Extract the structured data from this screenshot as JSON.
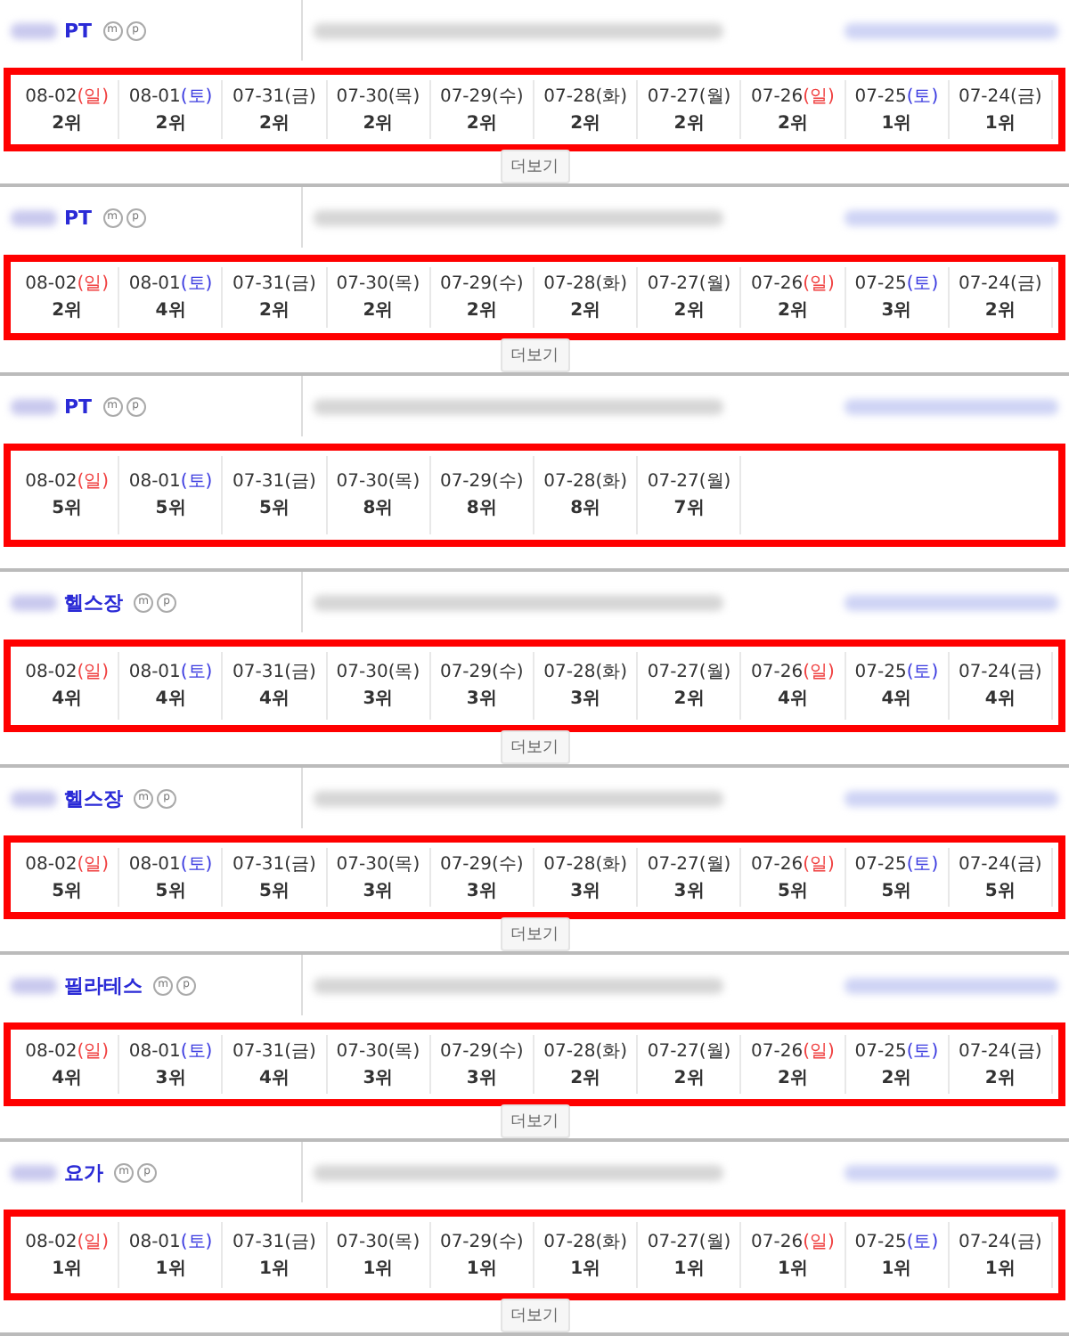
{
  "sections": [
    {
      "keyword": "PT",
      "badges": [
        "m",
        "p"
      ],
      "more_button": "더보기",
      "days": [
        {
          "date": "08-02",
          "day": "(일)",
          "kind": "sunday",
          "rank": "2위"
        },
        {
          "date": "08-01",
          "day": "(토)",
          "kind": "saturday",
          "rank": "2위"
        },
        {
          "date": "07-31",
          "day": "(금)",
          "kind": "weekday",
          "rank": "2위"
        },
        {
          "date": "07-30",
          "day": "(목)",
          "kind": "weekday",
          "rank": "2위"
        },
        {
          "date": "07-29",
          "day": "(수)",
          "kind": "weekday",
          "rank": "2위"
        },
        {
          "date": "07-28",
          "day": "(화)",
          "kind": "weekday",
          "rank": "2위"
        },
        {
          "date": "07-27",
          "day": "(월)",
          "kind": "weekday",
          "rank": "2위"
        },
        {
          "date": "07-26",
          "day": "(일)",
          "kind": "sunday",
          "rank": "2위"
        },
        {
          "date": "07-25",
          "day": "(토)",
          "kind": "saturday",
          "rank": "1위"
        },
        {
          "date": "07-24",
          "day": "(금)",
          "kind": "weekday",
          "rank": "1위"
        }
      ]
    },
    {
      "keyword": "PT",
      "badges": [
        "m",
        "p"
      ],
      "more_button": "더보기",
      "days": [
        {
          "date": "08-02",
          "day": "(일)",
          "kind": "sunday",
          "rank": "2위"
        },
        {
          "date": "08-01",
          "day": "(토)",
          "kind": "saturday",
          "rank": "4위"
        },
        {
          "date": "07-31",
          "day": "(금)",
          "kind": "weekday",
          "rank": "2위"
        },
        {
          "date": "07-30",
          "day": "(목)",
          "kind": "weekday",
          "rank": "2위"
        },
        {
          "date": "07-29",
          "day": "(수)",
          "kind": "weekday",
          "rank": "2위"
        },
        {
          "date": "07-28",
          "day": "(화)",
          "kind": "weekday",
          "rank": "2위"
        },
        {
          "date": "07-27",
          "day": "(월)",
          "kind": "weekday",
          "rank": "2위"
        },
        {
          "date": "07-26",
          "day": "(일)",
          "kind": "sunday",
          "rank": "2위"
        },
        {
          "date": "07-25",
          "day": "(토)",
          "kind": "saturday",
          "rank": "3위"
        },
        {
          "date": "07-24",
          "day": "(금)",
          "kind": "weekday",
          "rank": "2위"
        }
      ]
    },
    {
      "keyword": "PT",
      "badges": [
        "m",
        "p"
      ],
      "days": [
        {
          "date": "08-02",
          "day": "(일)",
          "kind": "sunday",
          "rank": "5위"
        },
        {
          "date": "08-01",
          "day": "(토)",
          "kind": "saturday",
          "rank": "5위"
        },
        {
          "date": "07-31",
          "day": "(금)",
          "kind": "weekday",
          "rank": "5위"
        },
        {
          "date": "07-30",
          "day": "(목)",
          "kind": "weekday",
          "rank": "8위"
        },
        {
          "date": "07-29",
          "day": "(수)",
          "kind": "weekday",
          "rank": "8위"
        },
        {
          "date": "07-28",
          "day": "(화)",
          "kind": "weekday",
          "rank": "8위"
        },
        {
          "date": "07-27",
          "day": "(월)",
          "kind": "weekday",
          "rank": "7위"
        }
      ]
    },
    {
      "keyword": "헬스장",
      "badges": [
        "m",
        "p"
      ],
      "more_button": "더보기",
      "days": [
        {
          "date": "08-02",
          "day": "(일)",
          "kind": "sunday",
          "rank": "4위"
        },
        {
          "date": "08-01",
          "day": "(토)",
          "kind": "saturday",
          "rank": "4위"
        },
        {
          "date": "07-31",
          "day": "(금)",
          "kind": "weekday",
          "rank": "4위"
        },
        {
          "date": "07-30",
          "day": "(목)",
          "kind": "weekday",
          "rank": "3위"
        },
        {
          "date": "07-29",
          "day": "(수)",
          "kind": "weekday",
          "rank": "3위"
        },
        {
          "date": "07-28",
          "day": "(화)",
          "kind": "weekday",
          "rank": "3위"
        },
        {
          "date": "07-27",
          "day": "(월)",
          "kind": "weekday",
          "rank": "2위"
        },
        {
          "date": "07-26",
          "day": "(일)",
          "kind": "sunday",
          "rank": "4위"
        },
        {
          "date": "07-25",
          "day": "(토)",
          "kind": "saturday",
          "rank": "4위"
        },
        {
          "date": "07-24",
          "day": "(금)",
          "kind": "weekday",
          "rank": "4위"
        }
      ]
    },
    {
      "keyword": "헬스장",
      "badges": [
        "m",
        "p"
      ],
      "more_button": "더보기",
      "days": [
        {
          "date": "08-02",
          "day": "(일)",
          "kind": "sunday",
          "rank": "5위"
        },
        {
          "date": "08-01",
          "day": "(토)",
          "kind": "saturday",
          "rank": "5위"
        },
        {
          "date": "07-31",
          "day": "(금)",
          "kind": "weekday",
          "rank": "5위"
        },
        {
          "date": "07-30",
          "day": "(목)",
          "kind": "weekday",
          "rank": "3위"
        },
        {
          "date": "07-29",
          "day": "(수)",
          "kind": "weekday",
          "rank": "3위"
        },
        {
          "date": "07-28",
          "day": "(화)",
          "kind": "weekday",
          "rank": "3위"
        },
        {
          "date": "07-27",
          "day": "(월)",
          "kind": "weekday",
          "rank": "3위"
        },
        {
          "date": "07-26",
          "day": "(일)",
          "kind": "sunday",
          "rank": "5위"
        },
        {
          "date": "07-25",
          "day": "(토)",
          "kind": "saturday",
          "rank": "5위"
        },
        {
          "date": "07-24",
          "day": "(금)",
          "kind": "weekday",
          "rank": "5위"
        }
      ]
    },
    {
      "keyword": "필라테스",
      "badges": [
        "m",
        "p"
      ],
      "more_button": "더보기",
      "days": [
        {
          "date": "08-02",
          "day": "(일)",
          "kind": "sunday",
          "rank": "4위"
        },
        {
          "date": "08-01",
          "day": "(토)",
          "kind": "saturday",
          "rank": "3위"
        },
        {
          "date": "07-31",
          "day": "(금)",
          "kind": "weekday",
          "rank": "4위"
        },
        {
          "date": "07-30",
          "day": "(목)",
          "kind": "weekday",
          "rank": "3위"
        },
        {
          "date": "07-29",
          "day": "(수)",
          "kind": "weekday",
          "rank": "3위"
        },
        {
          "date": "07-28",
          "day": "(화)",
          "kind": "weekday",
          "rank": "2위"
        },
        {
          "date": "07-27",
          "day": "(월)",
          "kind": "weekday",
          "rank": "2위"
        },
        {
          "date": "07-26",
          "day": "(일)",
          "kind": "sunday",
          "rank": "2위"
        },
        {
          "date": "07-25",
          "day": "(토)",
          "kind": "saturday",
          "rank": "2위"
        },
        {
          "date": "07-24",
          "day": "(금)",
          "kind": "weekday",
          "rank": "2위"
        }
      ]
    },
    {
      "keyword": "요가",
      "badges": [
        "m",
        "p"
      ],
      "more_button": "더보기",
      "days": [
        {
          "date": "08-02",
          "day": "(일)",
          "kind": "sunday",
          "rank": "1위"
        },
        {
          "date": "08-01",
          "day": "(토)",
          "kind": "saturday",
          "rank": "1위"
        },
        {
          "date": "07-31",
          "day": "(금)",
          "kind": "weekday",
          "rank": "1위"
        },
        {
          "date": "07-30",
          "day": "(목)",
          "kind": "weekday",
          "rank": "1위"
        },
        {
          "date": "07-29",
          "day": "(수)",
          "kind": "weekday",
          "rank": "1위"
        },
        {
          "date": "07-28",
          "day": "(화)",
          "kind": "weekday",
          "rank": "1위"
        },
        {
          "date": "07-27",
          "day": "(월)",
          "kind": "weekday",
          "rank": "1위"
        },
        {
          "date": "07-26",
          "day": "(일)",
          "kind": "sunday",
          "rank": "1위"
        },
        {
          "date": "07-25",
          "day": "(토)",
          "kind": "saturday",
          "rank": "1위"
        },
        {
          "date": "07-24",
          "day": "(금)",
          "kind": "weekday",
          "rank": "1위"
        }
      ]
    }
  ]
}
